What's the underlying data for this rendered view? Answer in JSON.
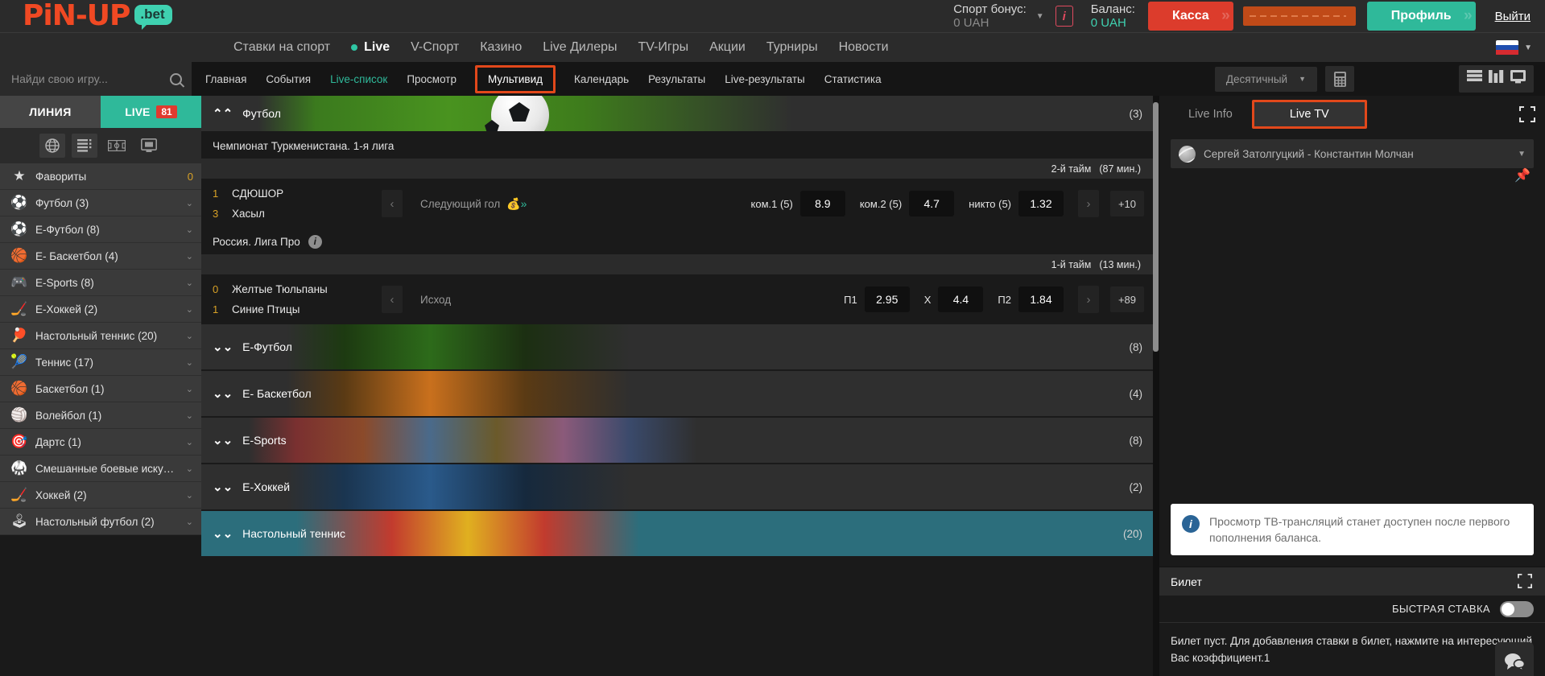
{
  "header": {
    "logo_main": "PiN-UP",
    "logo_suffix": ".bet",
    "bonus_label": "Спорт бонус:",
    "bonus_value": "0 UAH",
    "info_icon": "i",
    "balance_label": "Баланс:",
    "balance_value": "0 UAH",
    "kassa_label": "Касса",
    "profile_label": "Профиль",
    "logout_label": "Выйти"
  },
  "mainnav": {
    "items": [
      {
        "label": "Ставки на спорт",
        "active": false
      },
      {
        "label": "Live",
        "active": true
      },
      {
        "label": "V-Спорт",
        "active": false
      },
      {
        "label": "Казино",
        "active": false
      },
      {
        "label": "Live Дилеры",
        "active": false
      },
      {
        "label": "TV-Игры",
        "active": false
      },
      {
        "label": "Акции",
        "active": false
      },
      {
        "label": "Турниры",
        "active": false
      },
      {
        "label": "Новости",
        "active": false
      }
    ]
  },
  "search": {
    "placeholder": "Найди свою игру...",
    "value": ""
  },
  "subnav": {
    "items": [
      {
        "label": "Главная",
        "style": "normal"
      },
      {
        "label": "События",
        "style": "normal"
      },
      {
        "label": "Live-список",
        "style": "green"
      },
      {
        "label": "Просмотр",
        "style": "normal"
      },
      {
        "label": "Мультивид",
        "style": "boxed"
      },
      {
        "label": "Календарь",
        "style": "normal"
      },
      {
        "label": "Результаты",
        "style": "normal"
      },
      {
        "label": "Live-результаты",
        "style": "normal"
      },
      {
        "label": "Статистика",
        "style": "normal"
      }
    ],
    "odds_format": "Десятичный",
    "calculator_icon": "calculator-icon"
  },
  "sidebar": {
    "tab_line": "ЛИНИЯ",
    "tab_live": "LIVE",
    "live_count": "81",
    "items": [
      {
        "label": "Фавориты",
        "icon": "star-icon",
        "right": "0",
        "chevron": false
      },
      {
        "label": "Футбол (3)",
        "icon": "soccer-icon",
        "right": "",
        "chevron": true
      },
      {
        "label": "Е-Футбол (8)",
        "icon": "esoccer-icon",
        "right": "",
        "chevron": true
      },
      {
        "label": "Е- Баскетбол (4)",
        "icon": "ebasketball-icon",
        "right": "",
        "chevron": true
      },
      {
        "label": "E-Sports (8)",
        "icon": "gamepad-icon",
        "right": "",
        "chevron": true
      },
      {
        "label": "Е-Хоккей (2)",
        "icon": "ehockey-icon",
        "right": "",
        "chevron": true
      },
      {
        "label": "Настольный теннис (20)",
        "icon": "tabletennis-icon",
        "right": "",
        "chevron": true
      },
      {
        "label": "Теннис (17)",
        "icon": "tennis-icon",
        "right": "",
        "chevron": true
      },
      {
        "label": "Баскетбол (1)",
        "icon": "basketball-icon",
        "right": "",
        "chevron": true
      },
      {
        "label": "Волейбол (1)",
        "icon": "volleyball-icon",
        "right": "",
        "chevron": true
      },
      {
        "label": "Дартс (1)",
        "icon": "darts-icon",
        "right": "",
        "chevron": true
      },
      {
        "label": "Смешанные боевые искус…",
        "icon": "mma-icon",
        "right": "",
        "chevron": true
      },
      {
        "label": "Хоккей (2)",
        "icon": "hockey-icon",
        "right": "",
        "chevron": true
      },
      {
        "label": "Настольный футбол (2)",
        "icon": "tablefootball-icon",
        "right": "",
        "chevron": true
      }
    ]
  },
  "center": {
    "football_section": {
      "title": "Футбол",
      "count": "(3)"
    },
    "leagues": [
      {
        "name": "Чемпионат Туркменистана. 1-я лига",
        "has_info": false,
        "period": "2-й тайм",
        "period_time": "(87 мин.)",
        "match": {
          "home": "СДЮШОР",
          "home_score": "1",
          "away": "Хасыл",
          "away_score": "3",
          "market": "Следующий гол",
          "odds": [
            {
              "label": "ком.1 (5)",
              "value": "8.9"
            },
            {
              "label": "ком.2 (5)",
              "value": "4.7"
            },
            {
              "label": "никто (5)",
              "value": "1.32"
            }
          ],
          "more": "+10"
        }
      },
      {
        "name": "Россия. Лига Про",
        "has_info": true,
        "period": "1-й тайм",
        "period_time": "(13 мин.)",
        "match": {
          "home": "Желтые Тюльпаны",
          "home_score": "0",
          "away": "Синие Птицы",
          "away_score": "1",
          "market": "Исход",
          "odds": [
            {
              "label": "П1",
              "value": "2.95"
            },
            {
              "label": "X",
              "value": "4.4"
            },
            {
              "label": "П2",
              "value": "1.84"
            }
          ],
          "more": "+89"
        }
      }
    ],
    "collapsed_sections": [
      {
        "title": "Е-Футбол",
        "count": "(8)",
        "theme": "cr-ef"
      },
      {
        "title": "Е- Баскетбол",
        "count": "(4)",
        "theme": "cr-eb"
      },
      {
        "title": "E-Sports",
        "count": "(8)",
        "theme": "cr-es"
      },
      {
        "title": "Е-Хоккей",
        "count": "(2)",
        "theme": "cr-eh"
      },
      {
        "title": "Настольный теннис",
        "count": "(20)",
        "theme": "cr-tt"
      }
    ]
  },
  "right_panel": {
    "tab_live_info": "Live Info",
    "tab_live_tv": "Live TV",
    "match_selector": "Сергей Затолгуцкий - Константин Молчан",
    "notice": "Просмотр ТВ-трансляций станет доступен после первого пополнения баланса.",
    "ticket_title": "Билет",
    "fast_bet_label": "БЫСТРАЯ СТАВКА",
    "ticket_empty": "Билет пуст. Для добавления ставки в билет, нажмите на интересующий Вас коэффициент.1"
  },
  "colors": {
    "brand_orange": "#f04923",
    "brand_teal": "#3fd1b0",
    "accent_red": "#dc3c2c",
    "highlight_box": "#e2481b",
    "score_gold": "#d8a126"
  }
}
